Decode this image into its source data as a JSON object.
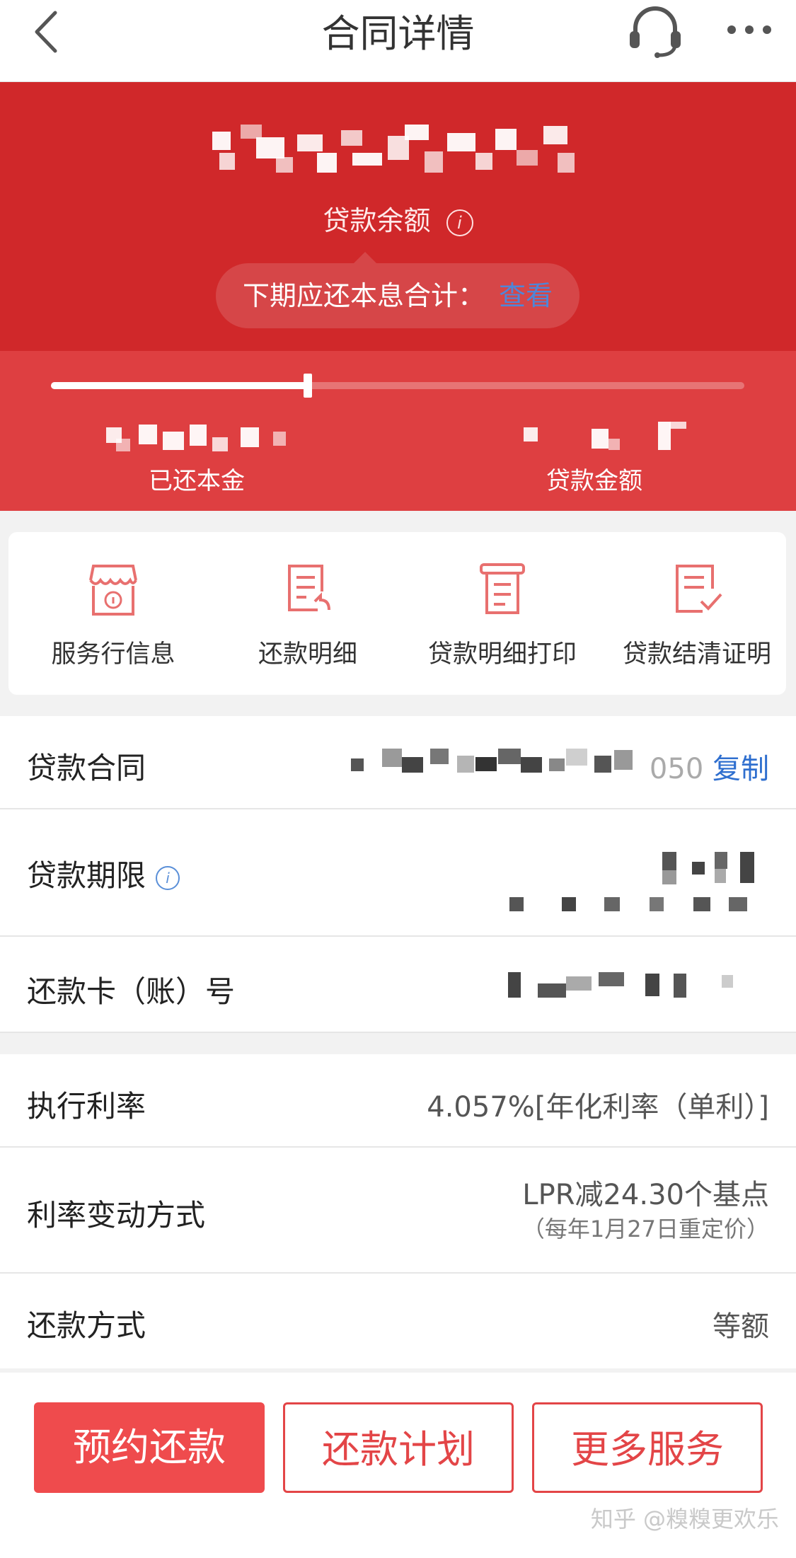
{
  "header": {
    "title": "合同详情"
  },
  "hero": {
    "balance_label": "贷款余额",
    "pill_text": "下期应还本息合计：",
    "pill_link": "查看",
    "repaid_label": "已还本金",
    "loan_amount_label": "贷款金额",
    "repaid_progress": 0.37
  },
  "services": [
    {
      "icon": "service-bank-icon",
      "label": "服务行信息"
    },
    {
      "icon": "repayment-detail-icon",
      "label": "还款明细"
    },
    {
      "icon": "print-detail-icon",
      "label": "贷款明细打印"
    },
    {
      "icon": "settlement-certificate-icon",
      "label": "贷款结清证明"
    }
  ],
  "contract_rows": [
    {
      "key": "贷款合同",
      "suffix": "050",
      "action": "复制"
    },
    {
      "key": "贷款期限"
    },
    {
      "key": "还款卡（账）号"
    }
  ],
  "rate_rows": [
    {
      "key": "执行利率",
      "value": "4.057%[年化利率（单利）]"
    },
    {
      "key": "利率变动方式",
      "value": "LPR减24.30个基点",
      "sub": "（每年1月27日重定价）"
    },
    {
      "key": "还款方式",
      "value": "等额"
    }
  ],
  "buttons": {
    "appointment": "预约还款",
    "plan": "还款计划",
    "more": "更多服务"
  },
  "watermark": "知乎 @糗糗更欢乐",
  "colors": {
    "hero": "#d0282a",
    "progress_band": "#de3f41",
    "accent_blue": "#2f6fcf",
    "button_red": "#ef4b4d"
  }
}
